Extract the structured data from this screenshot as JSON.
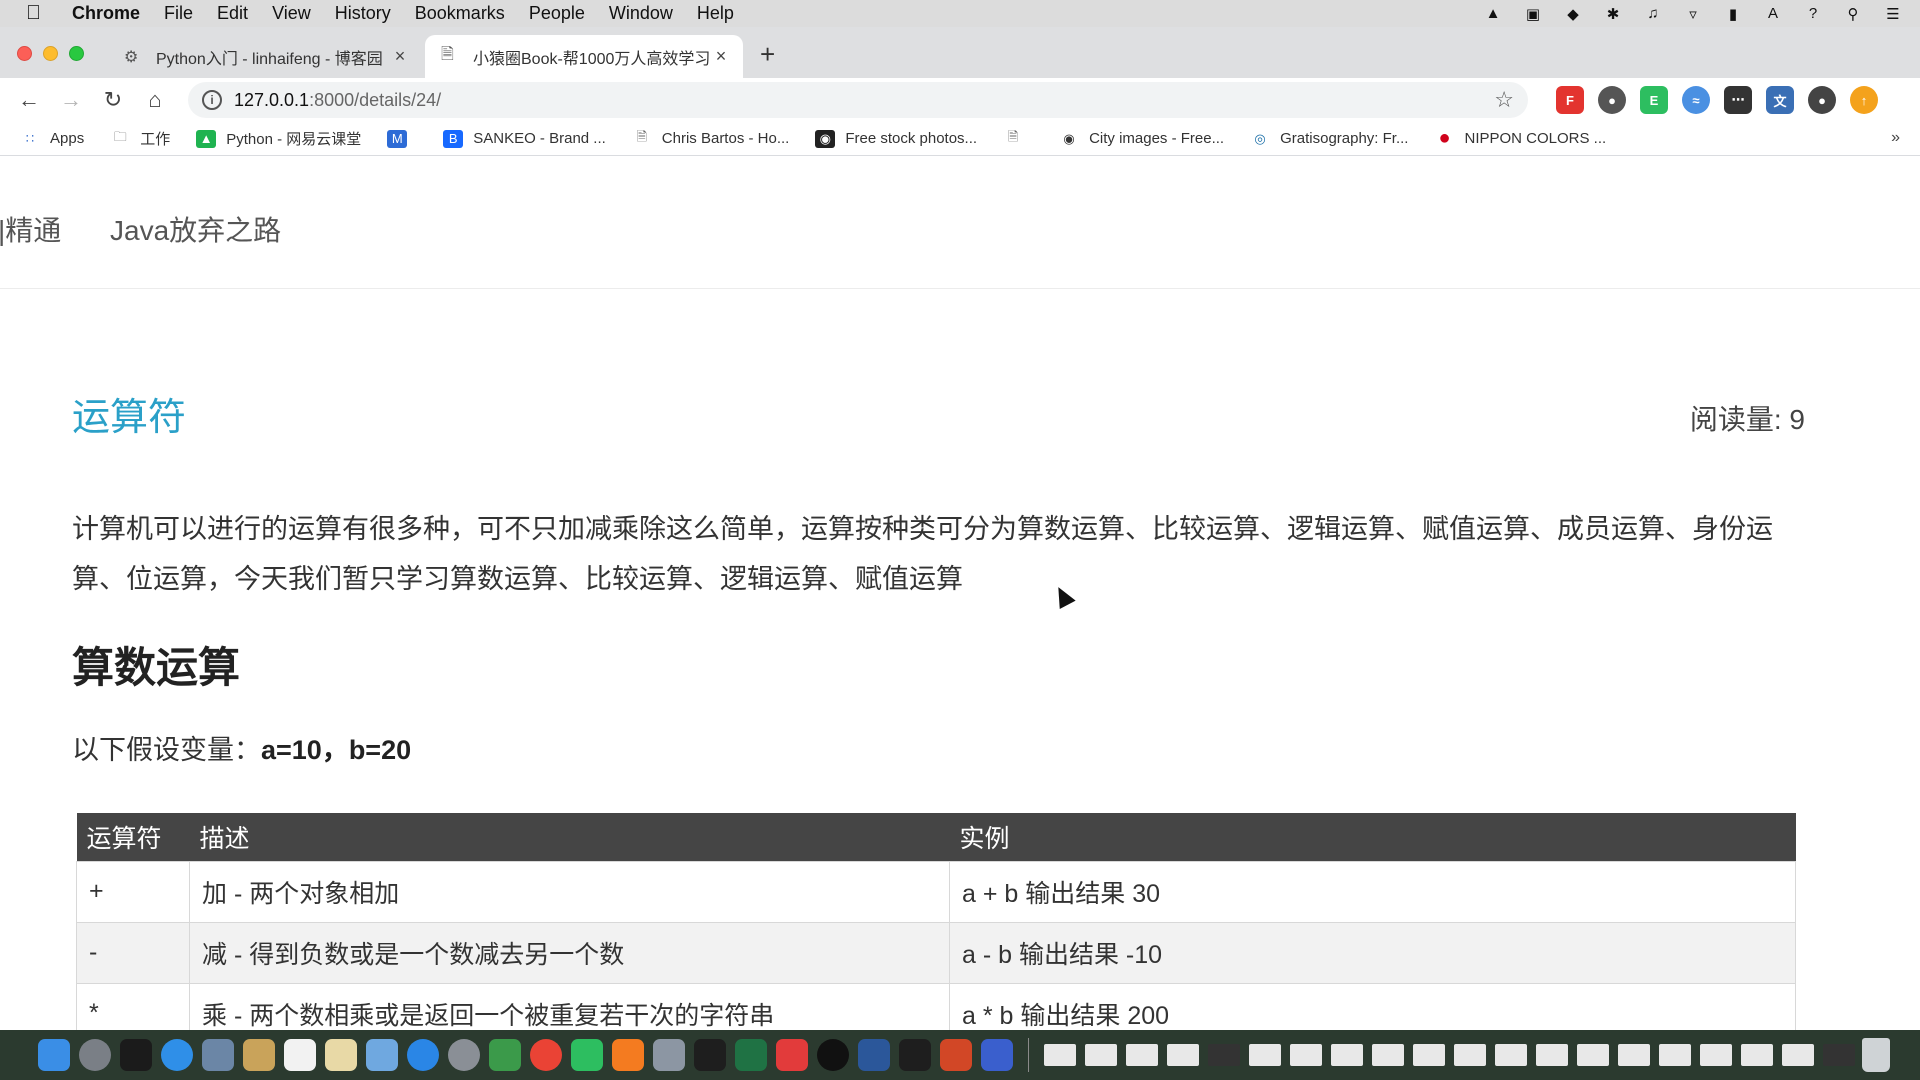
{
  "menubar": {
    "app": "Chrome",
    "items": [
      "File",
      "Edit",
      "View",
      "History",
      "Bookmarks",
      "People",
      "Window",
      "Help"
    ],
    "status_icons": [
      "evernote-icon",
      "screen-record-icon",
      "dropbox-icon",
      "bluetooth-icon",
      "volume-icon",
      "wifi-icon",
      "battery-icon",
      "input-source-icon",
      "help-icon",
      "spotlight-icon",
      "notification-center-icon"
    ]
  },
  "tabs": [
    {
      "title": "Python入门 - linhaifeng - 博客园",
      "icon": "site-favicon",
      "active": false
    },
    {
      "title": "小猿圈Book-帮1000万人高效学习",
      "icon": "page-icon",
      "active": true
    }
  ],
  "toolbar": {
    "url_host": "127.0.0.1",
    "url_path": ":8000/details/24/"
  },
  "bookmarks": [
    {
      "label": "Apps",
      "icon": "apps-grid-icon"
    },
    {
      "label": "工作",
      "icon": "folder-icon"
    },
    {
      "label": "Python - 网易云课堂",
      "icon": "netease-icon"
    },
    {
      "label": "",
      "icon": "mail-icon"
    },
    {
      "label": "SANKEO - Brand ...",
      "icon": "behance-icon"
    },
    {
      "label": "Chris Bartos - Ho...",
      "icon": "page-icon"
    },
    {
      "label": "Free stock photos...",
      "icon": "camera-icon"
    },
    {
      "label": "",
      "icon": "page-icon"
    },
    {
      "label": "City images - Free...",
      "icon": "camera-icon"
    },
    {
      "label": "Gratisography: Fr...",
      "icon": "gratisography-icon"
    },
    {
      "label": "NIPPON COLORS ...",
      "icon": "red-circle-icon"
    }
  ],
  "site_nav": {
    "item_partial": "|精通",
    "item_java": "Java放弃之路"
  },
  "article": {
    "title": "运算符",
    "views": "阅读量: 9",
    "intro": "计算机可以进行的运算有很多种，可不只加减乘除这么简单，运算按种类可分为算数运算、比较运算、逻辑运算、赋值运算、成员运算、身份运算、位运算，今天我们暂只学习算数运算、比较运算、逻辑运算、赋值运算",
    "h2": "算数运算",
    "vars_label": "以下假设变量：",
    "vars_value": "a=10，b=20",
    "table": {
      "headers": [
        "运算符",
        "描述",
        "实例"
      ],
      "rows": [
        [
          "+",
          "加 - 两个对象相加",
          "a + b 输出结果 30"
        ],
        [
          "-",
          "减 - 得到负数或是一个数减去另一个数",
          "a - b 输出结果 -10"
        ],
        [
          "*",
          "乘 - 两个数相乘或是返回一个被重复若干次的字符串",
          "a * b 输出结果 200"
        ]
      ]
    }
  },
  "colors": {
    "title_accent": "#2aa0c8",
    "table_header_bg": "#454545"
  }
}
